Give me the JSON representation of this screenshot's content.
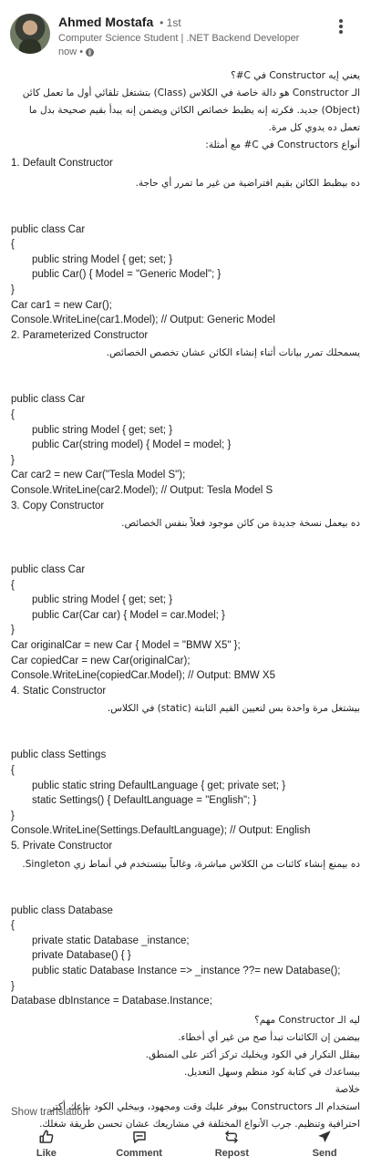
{
  "post": {
    "author": "Ahmed Mostafa",
    "degree": "• 1st",
    "headline": "Computer Science Student | .NET Backend Developer",
    "time": "now •"
  },
  "content": {
    "intro1": "يعني إيه Constructor في C#؟",
    "intro2": "الـ Constructor هو دالة خاصة في الكلاس (Class) بتشتغل تلقائي أول ما تعمل كائن",
    "intro3": "(Object) جديد. فكرته إنه يظبط خصائص الكائن ويضمن إنه يبدأ بقيم صحيحة بدل ما",
    "intro4": "تعمل ده يدوي كل مرة.",
    "intro5": "أنواع Constructors في C# مع أمثلة:",
    "s1_title": "1. Default Constructor",
    "s1_desc": "ده بيظبط الكائن بقيم افتراضية من غير ما تمرر أي حاجة.",
    "s1_code": [
      "public class Car",
      "{",
      "public string Model { get; set; }",
      "public Car() { Model = \"Generic Model\"; }",
      "}",
      "Car car1 = new Car();",
      "Console.WriteLine(car1.Model); // Output: Generic Model"
    ],
    "s2_title": "2. Parameterized Constructor",
    "s2_desc": "يسمحلك تمرر بيانات أثناء إنشاء الكائن عشان تخصص الخصائص.",
    "s2_code": [
      "public class Car",
      "{",
      "public string Model { get; set; }",
      "public Car(string model) { Model = model; }",
      "}",
      "Car car2 = new Car(\"Tesla Model S\");",
      "Console.WriteLine(car2.Model); // Output: Tesla Model S"
    ],
    "s3_title": "3. Copy Constructor",
    "s3_desc": "ده بيعمل نسخة جديدة من كائن موجود فعلاً بنفس الخصائص.",
    "s3_code": [
      "public class Car",
      "{",
      "public string Model { get; set; }",
      "public Car(Car car) { Model = car.Model; }",
      "}",
      "Car originalCar = new Car { Model = \"BMW X5\" };",
      "Car copiedCar = new Car(originalCar);",
      "Console.WriteLine(copiedCar.Model); // Output: BMW X5"
    ],
    "s4_title": "4. Static Constructor",
    "s4_desc": "بيشتغل مرة واحدة بس لتعيين القيم الثابتة (static) في الكلاس.",
    "s4_code": [
      "public class Settings",
      "{",
      "public static string DefaultLanguage { get; private set; }",
      "static Settings() { DefaultLanguage = \"English\"; }",
      "}",
      "Console.WriteLine(Settings.DefaultLanguage); // Output: English"
    ],
    "s5_title": "5. Private Constructor",
    "s5_desc": "ده بيمنع إنشاء كائنات من الكلاس مباشرة، وغالباً بيتستخدم في أنماط زي Singleton.",
    "s5_code": [
      "public class Database",
      "{",
      "private static Database _instance;",
      "private Database() { }",
      "public static Database Instance => _instance ??= new Database();",
      "}",
      "Database dbInstance = Database.Instance;"
    ],
    "why_title": "ليه الـ Constructor مهم؟",
    "why1": "بيضمن إن الكائنات تبدأ صح من غير أي أخطاء.",
    "why2": "بيقلل التكرار في الكود ويخليك تركز أكتر على المنطق.",
    "why3": "بيساعدك في كتابة كود منظم وسهل التعديل.",
    "summary_title": "خلاصة",
    "summary1": "استخدام الـ Constructors بيوفر عليك وقت ومجهود، وبيخلي الكود بتاعك أكتر",
    "summary2": "احترافية وتنظيم. جرب الأنواع المختلفة في مشاريعك عشان تحسن طريقة شغلك."
  },
  "show_translation": "Show translation",
  "actions": {
    "like": "Like",
    "comment": "Comment",
    "repost": "Repost",
    "send": "Send"
  },
  "icons": [
    "thumbs-up-icon",
    "comment-icon",
    "repost-icon",
    "send-icon",
    "more-icon",
    "globe-icon"
  ]
}
